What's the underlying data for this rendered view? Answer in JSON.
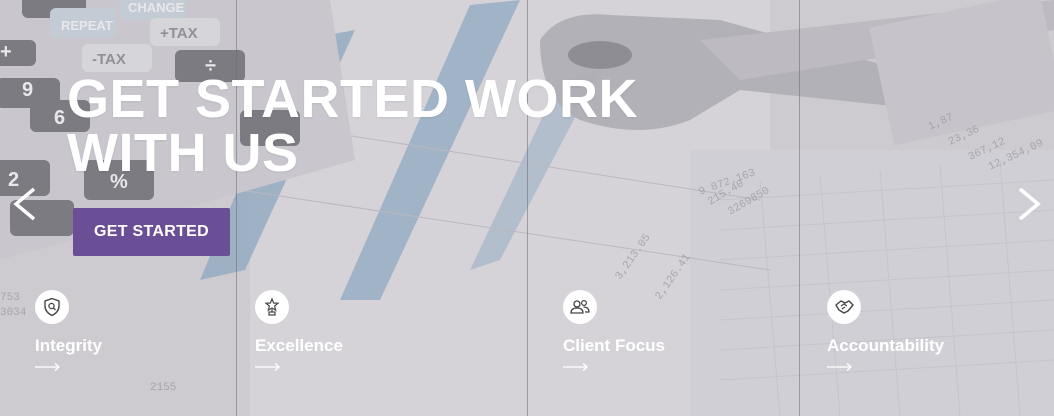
{
  "hero": {
    "headline": "GET STARTED WORK WITH US",
    "cta_label": "GET STARTED"
  },
  "features": [
    {
      "label": "Integrity",
      "icon": "shield-search-icon"
    },
    {
      "label": "Excellence",
      "icon": "trophy-icon"
    },
    {
      "label": "Client Focus",
      "icon": "users-icon"
    },
    {
      "label": "Accountability",
      "icon": "handshake-icon"
    }
  ],
  "calculator_keys": [
    "REPEAT",
    "CHANGE",
    "-TAX",
    "+TAX",
    "9",
    "6",
    "2",
    "%",
    "+",
    "÷"
  ],
  "colors": {
    "cta": "#6a4f96",
    "headline": "#ffffff",
    "chart_bar": "#7aa0c0"
  }
}
